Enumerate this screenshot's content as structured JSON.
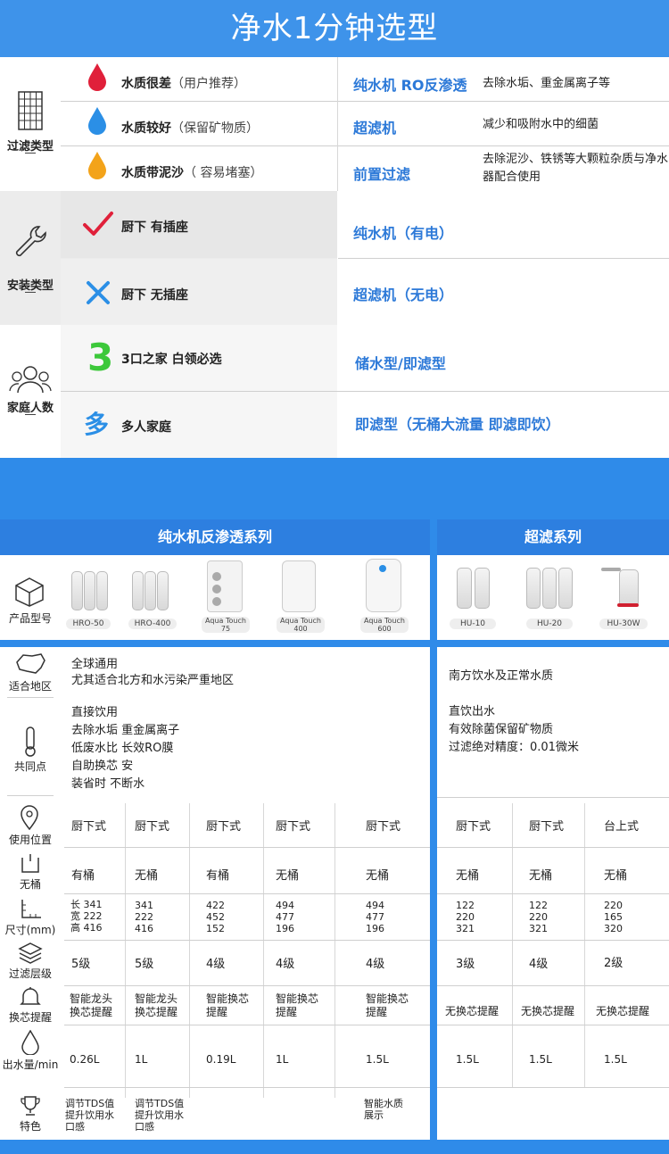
{
  "title": "净水1分钟选型",
  "filter_section": {
    "label": "过滤类型",
    "rows": [
      {
        "quality": "水质很差",
        "note": "（用户推荐）",
        "type": "纯水机 RO反渗透",
        "desc": "去除水垢、重金属离子等",
        "drop_color": "#e0203a"
      },
      {
        "quality": "水质较好",
        "note": "（保留矿物质）",
        "type": "超滤机",
        "desc": "减少和吸附水中的细菌",
        "drop_color": "#2b8fe6"
      },
      {
        "quality": "水质带泥沙",
        "note": "（ 容易堵塞）",
        "type": "前置过滤",
        "desc": "去除泥沙、铁锈等大颗粒杂质与净水器配合使用",
        "drop_color": "#f3a31a"
      }
    ]
  },
  "install_section": {
    "label": "安装类型",
    "rows": [
      {
        "condition": "厨下 有插座",
        "type": "纯水机（有电）"
      },
      {
        "condition": "厨下 无插座",
        "type": "超滤机（无电）"
      }
    ]
  },
  "family_section": {
    "label": "家庭人数",
    "rows": [
      {
        "badge": "3",
        "condition": "3口之家 白领必选",
        "type": "储水型/即滤型"
      },
      {
        "badge": "多",
        "condition": "多人家庭",
        "type": "即滤型（无桶大流量 即滤即饮）"
      }
    ]
  },
  "series": {
    "ro_title": "纯水机反渗透系列",
    "uf_title": "超滤系列"
  },
  "labels": {
    "model": "产品型号",
    "region": "适合地区",
    "common": "共同点",
    "position": "使用位置",
    "tank": "无桶",
    "size": "尺寸(mm)",
    "layers": "过滤层级",
    "reminder": "换芯提醒",
    "flow": "出水量/min",
    "feature": "特色"
  },
  "products": [
    "HRO-50",
    "HRO-400",
    "Aqua Touch 75",
    "Aqua Touch 400",
    "Aqua Touch 600",
    "HU-10",
    "HU-20",
    "HU-30W"
  ],
  "region": {
    "ro": [
      "全球通用",
      "尤其适合北方和水污染严重地区"
    ],
    "uf": [
      "南方饮水及正常水质"
    ]
  },
  "common": {
    "ro": [
      "直接饮用",
      "去除水垢 重金属离子",
      "低废水比 长效RO膜",
      "自助换芯 安",
      "装省时 不断水"
    ],
    "uf": [
      "直饮出水",
      "有效除菌保留矿物质",
      "过滤绝对精度：0.01微米"
    ]
  },
  "position": [
    "厨下式",
    "厨下式",
    "厨下式",
    "厨下式",
    "厨下式",
    "厨下式",
    "厨下式",
    "台上式"
  ],
  "tank": [
    "有桶",
    "无桶",
    "有桶",
    "无桶",
    "无桶",
    "无桶",
    "无桶",
    "无桶"
  ],
  "size": [
    [
      "长 341",
      "宽 222",
      "高 416"
    ],
    [
      "341",
      "222",
      "416"
    ],
    [
      "422",
      "452",
      "152"
    ],
    [
      "494",
      "477",
      "196"
    ],
    [
      "494",
      "477",
      "196"
    ],
    [
      "122",
      "220",
      "321"
    ],
    [
      "122",
      "220",
      "321"
    ],
    [
      "220",
      "165",
      "320"
    ]
  ],
  "layers": [
    "5级",
    "5级",
    "4级",
    "4级",
    "4级",
    "3级",
    "4级",
    "2级"
  ],
  "reminder": [
    [
      "智能龙头",
      "换芯提醒"
    ],
    [
      "智能龙头",
      "换芯提醒"
    ],
    [
      "智能换芯",
      "提醒"
    ],
    [
      "智能换芯",
      "提醒"
    ],
    [
      "智能换芯",
      "提醒"
    ],
    [
      "无换芯提醒"
    ],
    [
      "无换芯提醒"
    ],
    [
      "无换芯提醒"
    ]
  ],
  "flow": [
    "0.26L",
    "1L",
    "0.19L",
    "1L",
    "1.5L",
    "1.5L",
    "1.5L",
    "1.5L"
  ],
  "feature": [
    [
      "调节TDS值",
      "提升饮用水",
      "口感"
    ],
    [
      "调节TDS值",
      "提升饮用水",
      "口感"
    ],
    [],
    [],
    [
      "智能水质",
      "展示"
    ],
    [],
    [],
    []
  ],
  "colors": {
    "accent": "#2f8be9",
    "tab": "#2d7fe0",
    "type_text": "#2c79d8"
  }
}
